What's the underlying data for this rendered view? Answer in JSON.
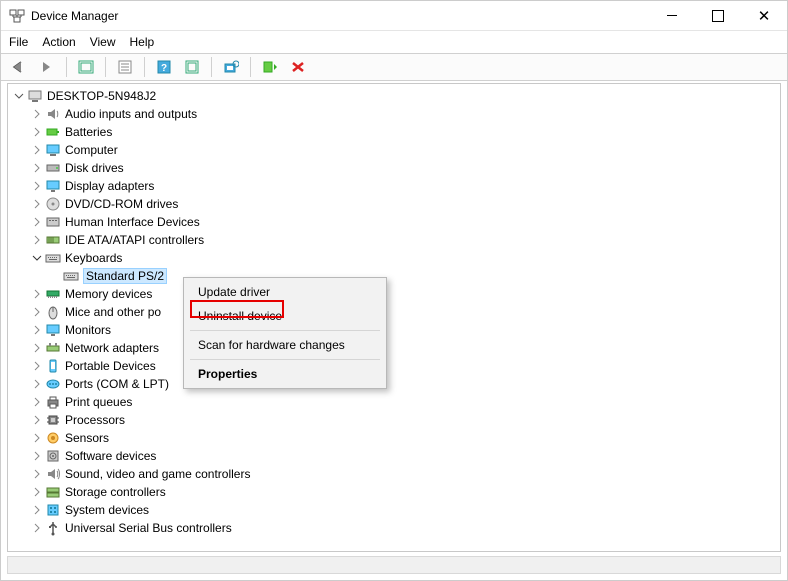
{
  "window": {
    "title": "Device Manager"
  },
  "menubar": {
    "file": "File",
    "action": "Action",
    "view": "View",
    "help": "Help"
  },
  "tree": {
    "root": "DESKTOP-5N948J2",
    "items": [
      "Audio inputs and outputs",
      "Batteries",
      "Computer",
      "Disk drives",
      "Display adapters",
      "DVD/CD-ROM drives",
      "Human Interface Devices",
      "IDE ATA/ATAPI controllers",
      "Keyboards",
      "Memory devices",
      "Mice and other po",
      "Monitors",
      "Network adapters",
      "Portable Devices",
      "Ports (COM & LPT)",
      "Print queues",
      "Processors",
      "Sensors",
      "Software devices",
      "Sound, video and game controllers",
      "Storage controllers",
      "System devices",
      "Universal Serial Bus controllers"
    ],
    "keyboard_child": "Standard PS/2"
  },
  "context_menu": {
    "update": "Update driver",
    "uninstall": "Uninstall device",
    "scan": "Scan for hardware changes",
    "properties": "Properties"
  }
}
